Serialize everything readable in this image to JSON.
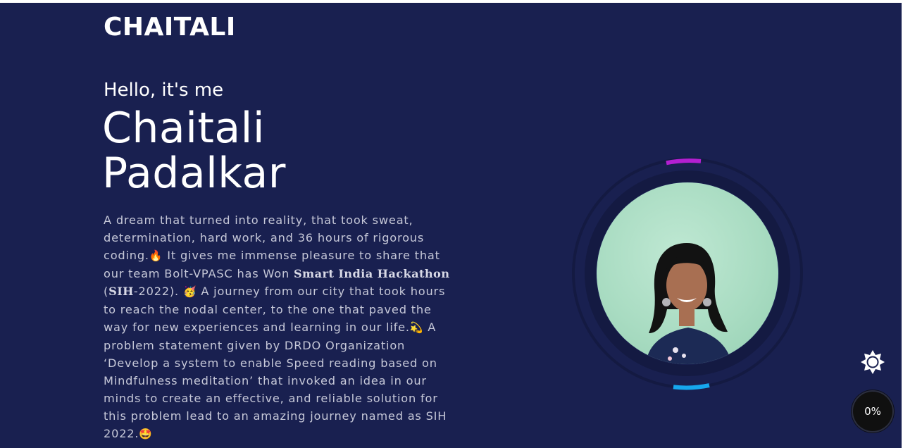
{
  "header": {
    "logo_text": "CHAITALI"
  },
  "hero": {
    "greeting": "Hello, it's me",
    "first_name": "Chaitali",
    "last_name": "Padalkar",
    "bio": {
      "p1": "A dream that turned into reality, that took sweat, determination, hard work, and 36 hours of rigorous coding.",
      "emoji1": "🔥",
      "p2": " It gives me immense pleasure to share that our team Bolt-VPASC has Won ",
      "hackathon": "Smart India Hackathon",
      "p3": " (",
      "sih": "SIH",
      "p4": "-2022). ",
      "emoji2": "🥳",
      "p5": " A journey from our city that took hours to reach the nodal center, to the one that paved the way for new experiences and learning in our life.",
      "emoji3": "💫",
      "p6": " A problem statement given by DRDO Organization ‘Develop a system to enable Speed reading based on Mindfulness meditation’ that invoked an idea in our minds to create an effective, and reliable solution for this problem lead to an amazing journey named as SIH 2022.",
      "emoji4": "🤩"
    }
  },
  "profile_image": {
    "ring_accent_top": "#b31fd1",
    "ring_accent_bottom": "#16a7ee"
  },
  "controls": {
    "theme_toggle_icon": "sun-icon",
    "scroll_progress": "0%"
  },
  "colors": {
    "background": "#192050",
    "text_primary": "#ffffff",
    "text_body": "#c6c8d8"
  }
}
